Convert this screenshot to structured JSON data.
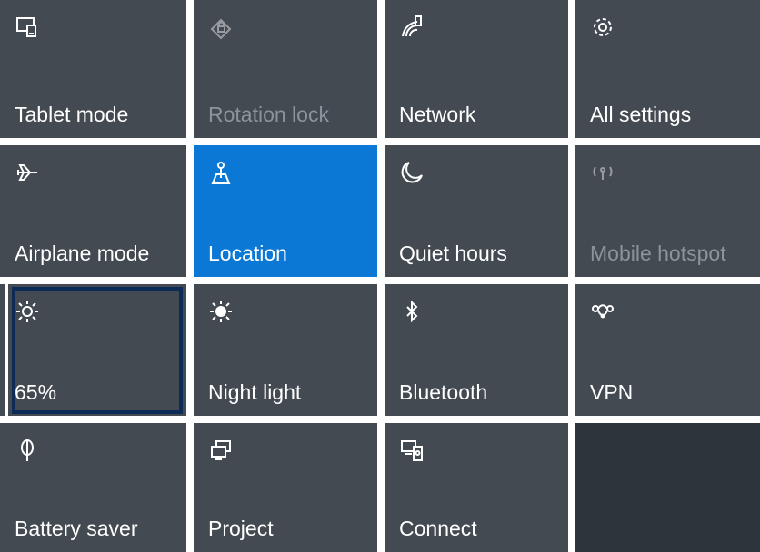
{
  "quick_actions": {
    "tiles": [
      {
        "label": "Tablet mode",
        "icon": "tablet-mode-icon",
        "state": "off"
      },
      {
        "label": "Rotation lock",
        "icon": "rotation-lock-icon",
        "state": "disabled"
      },
      {
        "label": "Network",
        "icon": "network-icon",
        "state": "off"
      },
      {
        "label": "All settings",
        "icon": "gear-icon",
        "state": "off"
      },
      {
        "label": "Airplane mode",
        "icon": "airplane-icon",
        "state": "off"
      },
      {
        "label": "Location",
        "icon": "location-icon",
        "state": "on"
      },
      {
        "label": "Quiet hours",
        "icon": "moon-icon",
        "state": "off"
      },
      {
        "label": "Mobile hotspot",
        "icon": "hotspot-icon",
        "state": "disabled"
      },
      {
        "label": "65%",
        "icon": "brightness-icon",
        "state": "focused"
      },
      {
        "label": "Night light",
        "icon": "night-light-icon",
        "state": "off"
      },
      {
        "label": "Bluetooth",
        "icon": "bluetooth-icon",
        "state": "off"
      },
      {
        "label": "VPN",
        "icon": "vpn-icon",
        "state": "off"
      },
      {
        "label": "Battery saver",
        "icon": "battery-saver-icon",
        "state": "off"
      },
      {
        "label": "Project",
        "icon": "project-icon",
        "state": "off"
      },
      {
        "label": "Connect",
        "icon": "connect-icon",
        "state": "off"
      }
    ]
  },
  "colors": {
    "tile": "#434a52",
    "active": "#0a78d4",
    "empty": "#2c343c",
    "focus_ring_outer": "#0d2b57",
    "disabled_text": "#8d939a"
  }
}
